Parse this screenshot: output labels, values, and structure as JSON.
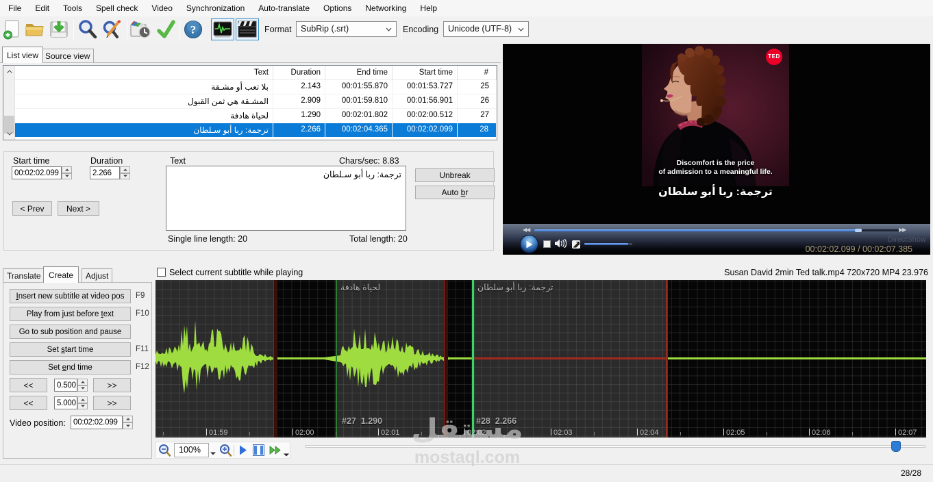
{
  "menu": {
    "items": [
      "File",
      "Edit",
      "Tools",
      "Spell check",
      "Video",
      "Synchronization",
      "Auto-translate",
      "Options",
      "Networking",
      "Help"
    ]
  },
  "toolbar": {
    "format_label": "Format",
    "format_value": "SubRip (.srt)",
    "encoding_label": "Encoding",
    "encoding_value": "Unicode (UTF-8)"
  },
  "view_tabs": {
    "list": "List view",
    "source": "Source view"
  },
  "table": {
    "headers": {
      "text": "Text",
      "duration": "Duration",
      "end": "End time",
      "start": "Start time",
      "number": "#"
    },
    "rows": [
      {
        "number": "25",
        "start": "00:01:53.727",
        "end": "00:01:55.870",
        "duration": "2.143",
        "text": "بلا تعب أو مشـقة"
      },
      {
        "number": "26",
        "start": "00:01:56.901",
        "end": "00:01:59.810",
        "duration": "2.909",
        "text": "المشـقة هي ثمن القبول"
      },
      {
        "number": "27",
        "start": "00:02:00.512",
        "end": "00:02:01.802",
        "duration": "1.290",
        "text": "لحياة هادفة"
      },
      {
        "number": "28",
        "start": "00:02:02.099",
        "end": "00:02:04.365",
        "duration": "2.266",
        "text": "ترجمة: ربا أبو سـلطان"
      }
    ]
  },
  "editor": {
    "start_time_label": "Start time",
    "start_time_value": "00:02:02.099",
    "duration_label": "Duration",
    "duration_value": "2.266",
    "text_label": "Text",
    "chars_per_sec": "Chars/sec: 8.83",
    "text_value": "ترجمة: ربا أبو سـلطان",
    "unbreak_label": "Unbreak",
    "autobr": {
      "pre": "Auto ",
      "u": "b",
      "post": "r"
    },
    "prev_label": "< Prev",
    "next_label": "Next >",
    "single_line_length": "Single line length: 20",
    "total_length": "Total length: 20"
  },
  "video": {
    "ted_logo": "TED",
    "subtitle_line1": "Discomfort is the price",
    "subtitle_line2": "of admission to a meaningful life.",
    "subtitle_arabic": "ترجمة: ربا أبو سلطان",
    "renderer": "DirectShow",
    "time": "00:02:02.099 / 00:02:07.385"
  },
  "bottom_tabs": {
    "translate": "Translate",
    "create": "Create",
    "adjust": "Adjust"
  },
  "create_panel": {
    "buttons": [
      {
        "pre": "",
        "u": "I",
        "post": "nsert new subtitle at video pos",
        "key": "F9"
      },
      {
        "pre": "Play from just before ",
        "u": "t",
        "post": "ext",
        "key": "F10"
      },
      {
        "pre": "Go to sub position and pause",
        "u": "",
        "post": "",
        "key": ""
      },
      {
        "pre": "Set ",
        "u": "s",
        "post": "tart time",
        "key": "F11"
      },
      {
        "pre": "Set ",
        "u": "e",
        "post": "nd time",
        "key": "F12"
      }
    ],
    "back_label": "<<",
    "forward_label": ">>",
    "nudge_small": "0.500",
    "nudge_large": "5.000",
    "video_position_label": "Video position:",
    "video_position_value": "00:02:02.099"
  },
  "waveform": {
    "select_checkbox_label": "Select current subtitle while playing",
    "media_info": "Susan David 2min Ted talk.mp4 720x720 MP4 23.976",
    "region27_label": "لحياة هادفة",
    "region28_label": "ترجمة: ربا أبو سلطان",
    "region27_info": "#27  1.290",
    "region28_info": "#28  2.266",
    "ticks": [
      "01:59",
      "02:00",
      "02:01",
      "02:02",
      "02:03",
      "02:04",
      "02:05",
      "02:06",
      "02:07"
    ],
    "zoom_value": "100%"
  },
  "status": {
    "position": "28/28"
  },
  "watermark": {
    "arabic": "مستقل",
    "latin": "mostaql.com"
  }
}
